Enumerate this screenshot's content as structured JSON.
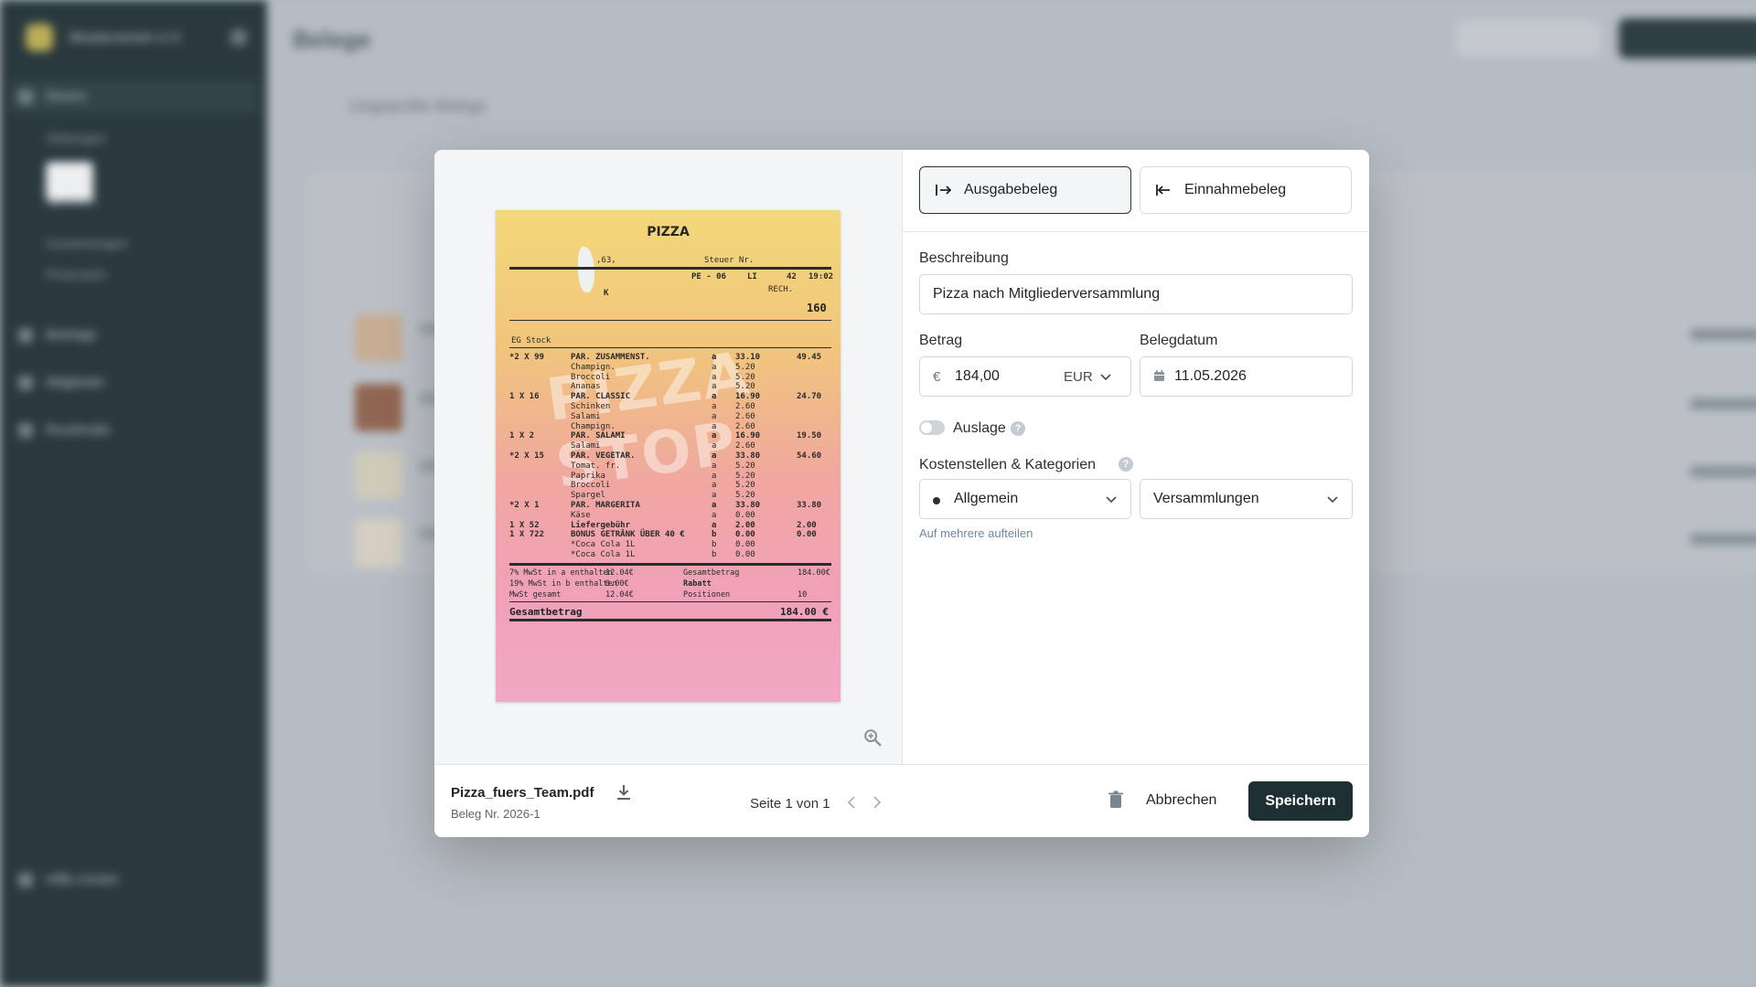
{
  "modal": {
    "type_toggle": {
      "expense_label": "Ausgabebeleg",
      "income_label": "Einnahmebeleg",
      "selected": "expense"
    },
    "description": {
      "label": "Beschreibung",
      "value": "Pizza nach Mitgliederversammlung"
    },
    "amount": {
      "label": "Betrag",
      "currency_symbol": "€",
      "value": "184,00",
      "currency": "EUR"
    },
    "date": {
      "label": "Belegdatum",
      "value": "11.05.2026"
    },
    "auslage": {
      "label": "Auslage",
      "enabled": false
    },
    "categories": {
      "label": "Kostenstellen & Kategorien",
      "cost_center": "Allgemein",
      "category": "Versammlungen",
      "split_link": "Auf mehrere aufteilen"
    },
    "footer": {
      "cancel_label": "Abbrechen",
      "save_label": "Speichern"
    },
    "preview": {
      "file_name": "Pizza_fuers_Team.pdf",
      "beleg_number": "Beleg Nr. 2026-1",
      "page_info": "Seite 1 von 1"
    },
    "receipt": {
      "title": "PIZZA",
      "watermark": "PIZZA STOP",
      "header_left": ",63,",
      "header_right": "Steuer Nr.",
      "line2_left": "PE - 06",
      "line2_mid": "LI",
      "line2_num": "42",
      "line2_time": "19:02",
      "rech": "RECH.",
      "rech_no": "160",
      "k": "K",
      "stock": "EG  Stock",
      "items": [
        {
          "qty": "*2  X 99",
          "name": "PAR. ZUSAMMENST.",
          "tax": "a",
          "price": "33.10",
          "total": "49.45"
        },
        {
          "qty": "",
          "name": "Champign.",
          "tax": "a",
          "price": "5.20",
          "total": ""
        },
        {
          "qty": "",
          "name": "Broccoli",
          "tax": "a",
          "price": "5.20",
          "total": ""
        },
        {
          "qty": "",
          "name": "Ananas",
          "tax": "a",
          "price": "5.20",
          "total": ""
        },
        {
          "qty": "1  X 16",
          "name": "PAR. CLASSIC",
          "tax": "a",
          "price": "16.90",
          "total": "24.70"
        },
        {
          "qty": "",
          "name": "Schinken",
          "tax": "a",
          "price": "2.60",
          "total": ""
        },
        {
          "qty": "",
          "name": "Salami",
          "tax": "a",
          "price": "2.60",
          "total": ""
        },
        {
          "qty": "",
          "name": "Champign.",
          "tax": "a",
          "price": "2.60",
          "total": ""
        },
        {
          "qty": "1  X 2",
          "name": "PAR. SALAMI",
          "tax": "a",
          "price": "16.90",
          "total": "19.50"
        },
        {
          "qty": "",
          "name": "Salami",
          "tax": "a",
          "price": "2.60",
          "total": ""
        },
        {
          "qty": "*2  X 15",
          "name": "PAR. VEGETAR.",
          "tax": "a",
          "price": "33.80",
          "total": "54.60"
        },
        {
          "qty": "",
          "name": "Tomat. fr.",
          "tax": "a",
          "price": "5.20",
          "total": ""
        },
        {
          "qty": "",
          "name": "Paprika",
          "tax": "a",
          "price": "5.20",
          "total": ""
        },
        {
          "qty": "",
          "name": "Broccoli",
          "tax": "a",
          "price": "5.20",
          "total": ""
        },
        {
          "qty": "",
          "name": "Spargel",
          "tax": "a",
          "price": "5.20",
          "total": ""
        },
        {
          "qty": "*2  X 1",
          "name": "PAR. MARGERITA",
          "tax": "a",
          "price": "33.80",
          "total": "33.80"
        },
        {
          "qty": "",
          "name": "Käse",
          "tax": "a",
          "price": "0.00",
          "total": ""
        },
        {
          "qty": "1  X 52",
          "name": "Liefergebühr",
          "tax": "a",
          "price": "2.00",
          "total": "2.00"
        },
        {
          "qty": "1  X 722",
          "name": "BONUS GETRÄNK ÜBER 40 €",
          "tax": "b",
          "price": "0.00",
          "total": "0.00"
        },
        {
          "qty": "",
          "name": "*Coca Cola 1L",
          "tax": "b",
          "price": "0.00",
          "total": ""
        },
        {
          "qty": "",
          "name": "*Coca Cola 1L",
          "tax": "b",
          "price": "0.00",
          "total": ""
        }
      ],
      "summary": [
        {
          "left": "7% MwSt in a enthalten",
          "mid": "12.04€",
          "label": "Gesamtbetrag",
          "value": "184.00€"
        },
        {
          "left": "19% MwSt in b enthalten",
          "mid": "0.00€",
          "label": "Rabatt",
          "value": ""
        },
        {
          "left": "MwSt gesamt",
          "mid": "12.04€",
          "label": "Positionen",
          "value": "10"
        }
      ],
      "total_label": "Gesamtbetrag",
      "total_value": "184.00 €"
    }
  },
  "background": {
    "sidebar": {
      "org_name": "Musterverein e.V.",
      "items": [
        "Dinero",
        "Beiträge",
        "Mitglieder",
        "Rundmails",
        "Hilfe-Center"
      ],
      "sub_items": [
        "Zahlungen",
        "Belege",
        "Spenden",
        "Auswertungen",
        "Finanzamt"
      ]
    },
    "main": {
      "title": "Belege",
      "subtitle": "Ungeprüfte Belege"
    }
  },
  "colors": {
    "primary": "#1d2f33",
    "sidebar_bg": "#2a3a3f",
    "link": "#6e89a6"
  }
}
